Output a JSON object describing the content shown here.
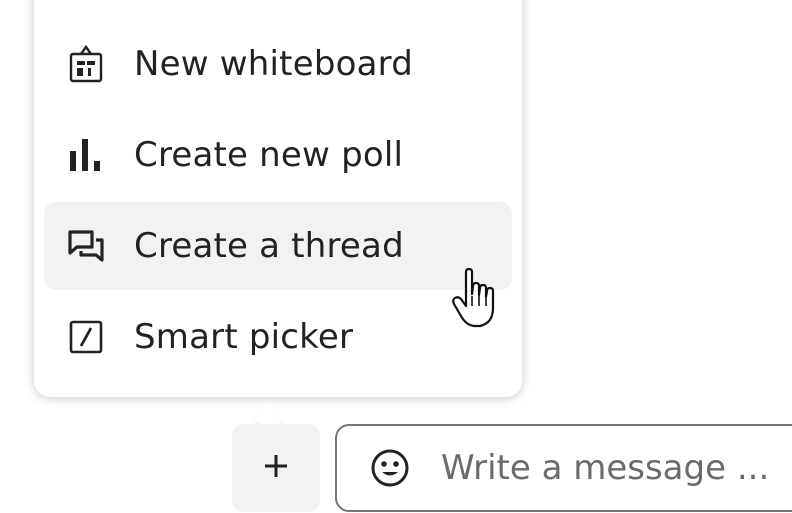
{
  "menu": {
    "items": [
      {
        "label": "New whiteboard",
        "icon": "whiteboard-icon"
      },
      {
        "label": "Create new poll",
        "icon": "poll-icon"
      },
      {
        "label": "Create a thread",
        "icon": "thread-icon",
        "hovered": true
      },
      {
        "label": "Smart picker",
        "icon": "smart-picker-icon"
      }
    ]
  },
  "composer": {
    "add_button_icon": "plus-icon",
    "emoji_icon": "emoji-icon",
    "placeholder": "Write a message ...",
    "value": ""
  },
  "colors": {
    "text": "#222222",
    "hover_bg": "#f2f2f2",
    "input_border": "#767676",
    "placeholder": "#6b6b6b"
  }
}
